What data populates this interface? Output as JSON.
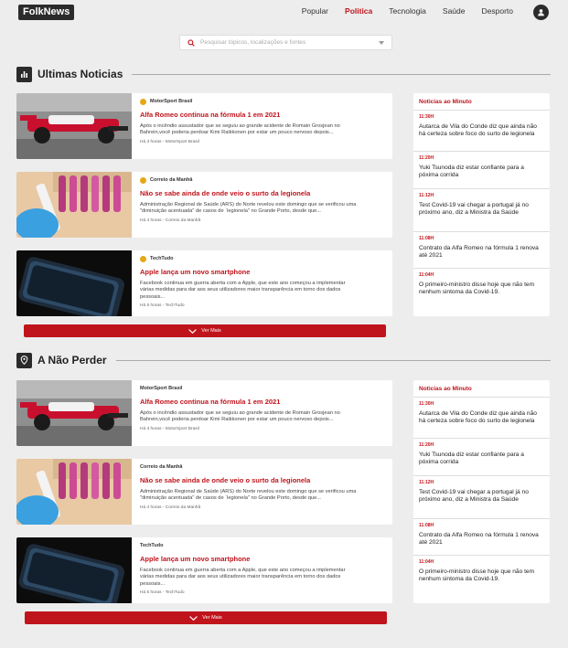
{
  "header": {
    "logo": "FolkNews",
    "nav": [
      "Popular",
      "Politica",
      "Tecnologia",
      "Saúde",
      "Desporto"
    ],
    "active_nav": "Politica"
  },
  "search": {
    "placeholder": "Pesquisar tópicos, localizações e fontes"
  },
  "sections": [
    {
      "title": "Ultimas Noticias",
      "more_label": "Ver Mais",
      "articles": [
        {
          "source": "MotorSport Brasil",
          "title": "Alfa Romeo continua na fórmula 1 em 2021",
          "desc": "Após o incêndio assustador que se seguiu ao grande acidente de Romain Grosjean no Bahrein,você poderia perdoar Kimi Raikkonen por estar um pouco nervoso depois...",
          "meta": "Há 3 horas - MotorSport Brasil"
        },
        {
          "source": "Correio da Manhã",
          "title": "Não se sabe ainda de onde veio o surto da legionela",
          "desc": "Administração Regional de Saúde (ARS) do Norte revelou este domingo que se verificou uma \"diminuição acentuada\" de casos de `legionela\" no Grande Porto, desde que...",
          "meta": "Há 4 horas - Correio da Manhã"
        },
        {
          "source": "TechTudo",
          "title": "Apple lança um novo smartphone",
          "desc": "Facebook continua em guerra aberta com a Apple, que este ano começou a implementar várias medidas para dar aos seus utilizadores maior transparência em torno dos dados pessoais...",
          "meta": "Há 5 horas - TechTudo"
        }
      ]
    },
    {
      "title": "A Não Perder",
      "more_label": "Ver Mais",
      "articles": [
        {
          "source": "MotorSport Brasil",
          "title": "Alfa Romeo continua na fórmula 1 em 2021",
          "desc": "Após o incêndio assustador que se seguiu ao grande acidente de Romain Grosjean no Bahrein,você poderia perdoar Kimi Raikkonen por estar um pouco nervoso depois...",
          "meta": "Há 3 horas - MotorSport Brasil"
        },
        {
          "source": "Correio da Manhã",
          "title": "Não se sabe ainda de onde veio o surto da legionela",
          "desc": "Administração Regional de Saúde (ARS) do Norte revelou este domingo que se verificou uma \"diminuição acentuada\" de casos de `legionela\" no Grande Porto, desde que...",
          "meta": "Há 4 horas - Correio da Manhã"
        },
        {
          "source": "TechTudo",
          "title": "Apple lança um novo smartphone",
          "desc": "Facebook continua em guerra aberta com a Apple, que este ano começou a implementar várias medidas para dar aos seus utilizadores maior transparência em torno dos dados pessoais...",
          "meta": "Há 5 horas - TechTudo"
        }
      ]
    }
  ],
  "sidebar_panels": [
    {
      "title": "Noticias ao Minuto",
      "items": [
        {
          "time": "11:30H",
          "text": "Autarca de Vila do Conde diz que ainda não há certeza sobre foco do surto de legionela"
        },
        {
          "time": "11:20H",
          "text": "Yuki Tsunoda diz estar confiante para a póxima corrida"
        },
        {
          "time": "11:12H",
          "text": "Test Covid-19 vai chegar a portugal já no próximo ano, diz a Ministra da Saúde"
        },
        {
          "time": "11:08H",
          "text": "Contrato da Alfa Romeo na fórmula 1 renova até 2021"
        },
        {
          "time": "11:04H",
          "text": "O primeiro-ministro disse hoje que não tem nenhum sintoma da Covid-19."
        }
      ]
    },
    {
      "title": "Noticias ao Minuto",
      "items": [
        {
          "time": "11:30H",
          "text": "Autarca de Vila do Conde diz que ainda não há certeza sobre foco do surto de legionela"
        },
        {
          "time": "11:20H",
          "text": "Yuki Tsunoda diz estar confiante para a póxima corrida"
        },
        {
          "time": "11:12H",
          "text": "Test Covid-19 vai chegar a portugal já no próximo ano, diz a Ministra da Saúde"
        },
        {
          "time": "11:08H",
          "text": "Contrato da Alfa Romeo na fórmula 1 renova até 2021"
        },
        {
          "time": "11:04H",
          "text": "O primeiro-ministro disse hoje que não tem nenhum sintoma da Covid-19."
        }
      ]
    }
  ],
  "colors": {
    "accent": "#c0141c",
    "dark": "#2b2b2b",
    "background": "#ededed"
  }
}
